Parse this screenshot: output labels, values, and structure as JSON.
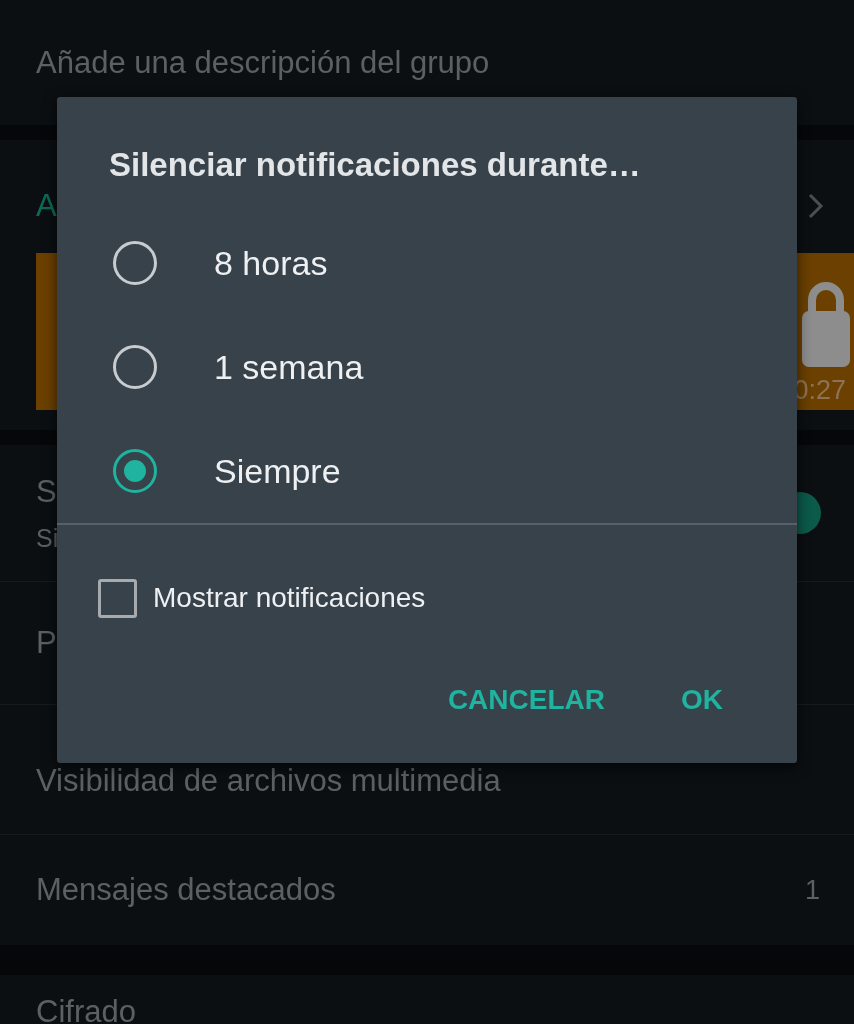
{
  "group_info": {
    "description": "Añade una descripción del grupo"
  },
  "media": {
    "heading": "A",
    "duration": "0:27"
  },
  "settings": [
    {
      "kind": "toggle",
      "title": "S",
      "subtitle": "Si",
      "on": true
    },
    {
      "kind": "plain",
      "title": "P"
    },
    {
      "kind": "plain",
      "title": "Visibilidad de archivos multimedia"
    },
    {
      "kind": "count",
      "title": "Mensajes destacados",
      "value": "1"
    }
  ],
  "encryption": {
    "title": "Cifrado"
  },
  "dialog": {
    "title": "Silenciar notificaciones durante…",
    "options": [
      {
        "label": "8 horas",
        "selected": false
      },
      {
        "label": "1 semana",
        "selected": false
      },
      {
        "label": "Siempre",
        "selected": true
      }
    ],
    "checkbox": {
      "label": "Mostrar notificaciones",
      "checked": false
    },
    "buttons": [
      {
        "label": "CANCELAR"
      },
      {
        "label": "OK"
      }
    ]
  }
}
